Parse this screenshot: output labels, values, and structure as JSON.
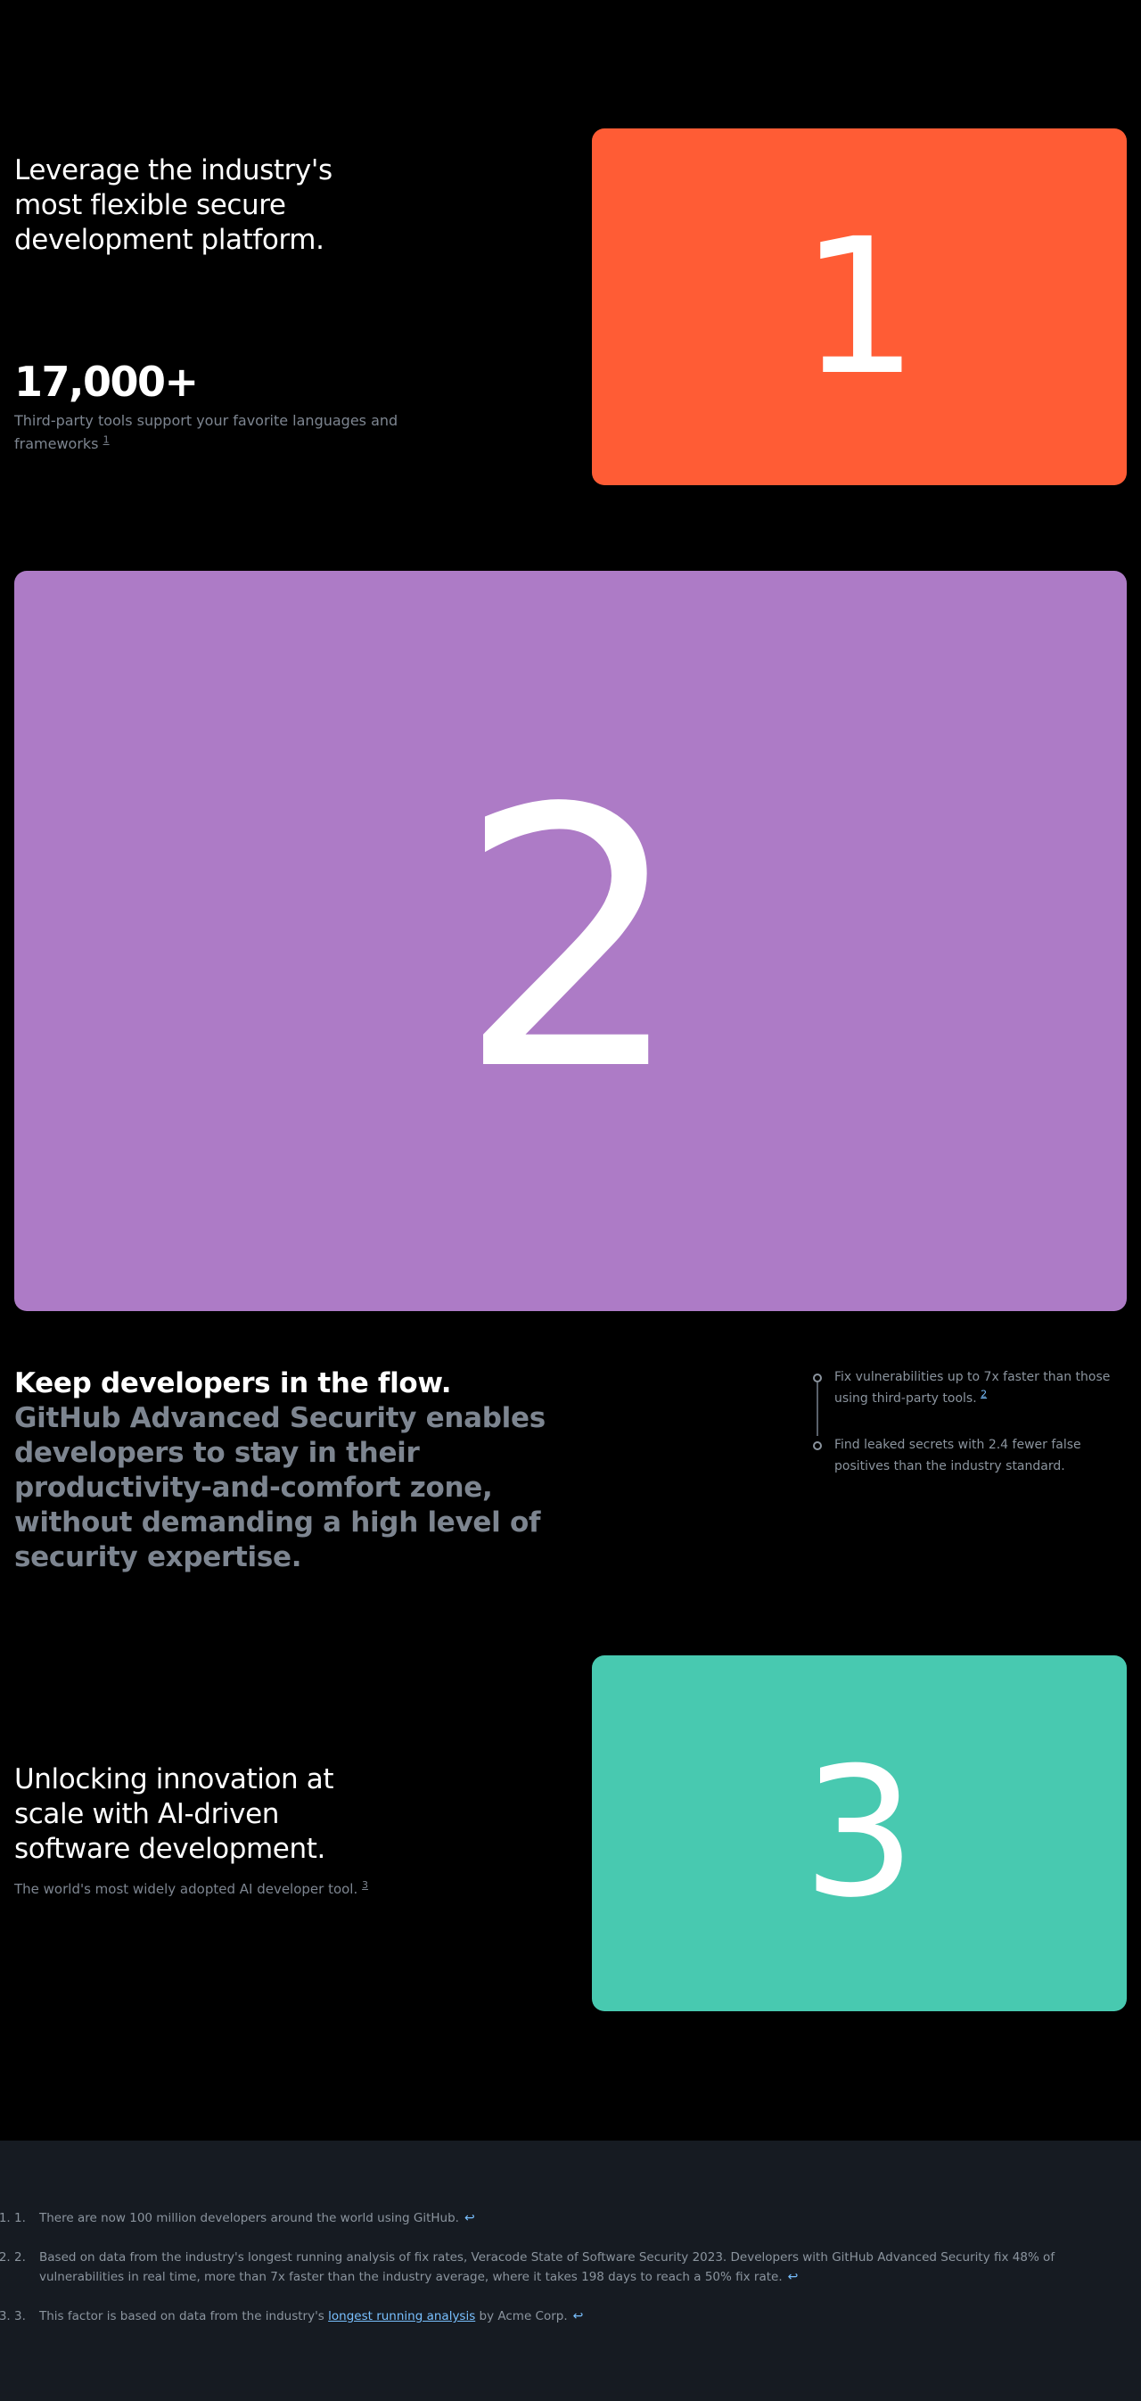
{
  "section1": {
    "headline": "Leverage the industry's most flexible secure development platform.",
    "stat": "17,000+",
    "desc": "Third-party tools support your favorite languages and frameworks",
    "footnote_ref": "1",
    "card_number": "1",
    "card_color": "#ff5c35"
  },
  "section2": {
    "card_number": "2",
    "card_color": "#ad7bc6",
    "lead": "Keep developers in the flow.",
    "rest": " GitHub Advanced Security enables developers to stay in their productivity-and-comfort zone, without demanding a high level of security expertise.",
    "bullets": [
      {
        "text": "Fix vulnerabilities up to 7x faster than those using third-party tools.",
        "ref": "2"
      },
      {
        "text": "Find leaked secrets with 2.4 fewer false positives than the industry standard.",
        "ref": ""
      }
    ]
  },
  "section3": {
    "headline": "Unlocking innovation at scale with AI-driven software development.",
    "desc": "The world's most widely adopted AI developer tool.",
    "footnote_ref": "3",
    "card_number": "3",
    "card_color": "#48c9b0"
  },
  "footnotes": [
    {
      "num": "1.",
      "text": "There are now 100 million developers around the world using GitHub.",
      "back": "↩"
    },
    {
      "num": "2.",
      "text": "Based on data from the industry's longest running analysis of fix rates, Veracode State of Software Security 2023. Developers with GitHub Advanced Security fix 48% of vulnerabilities in real time, more than 7x faster than the industry average, where it takes 198 days to reach a 50% fix rate.",
      "back": "↩"
    },
    {
      "num": "3.",
      "text_before": "This factor is based on data from the industry's ",
      "link": "longest running analysis",
      "text_after": " by Acme Corp.",
      "back": "↩"
    }
  ],
  "colors": {
    "background": "#000000",
    "footnote_bg": "#161b22",
    "muted_text": "#7d8590",
    "link": "#79c0ff"
  }
}
